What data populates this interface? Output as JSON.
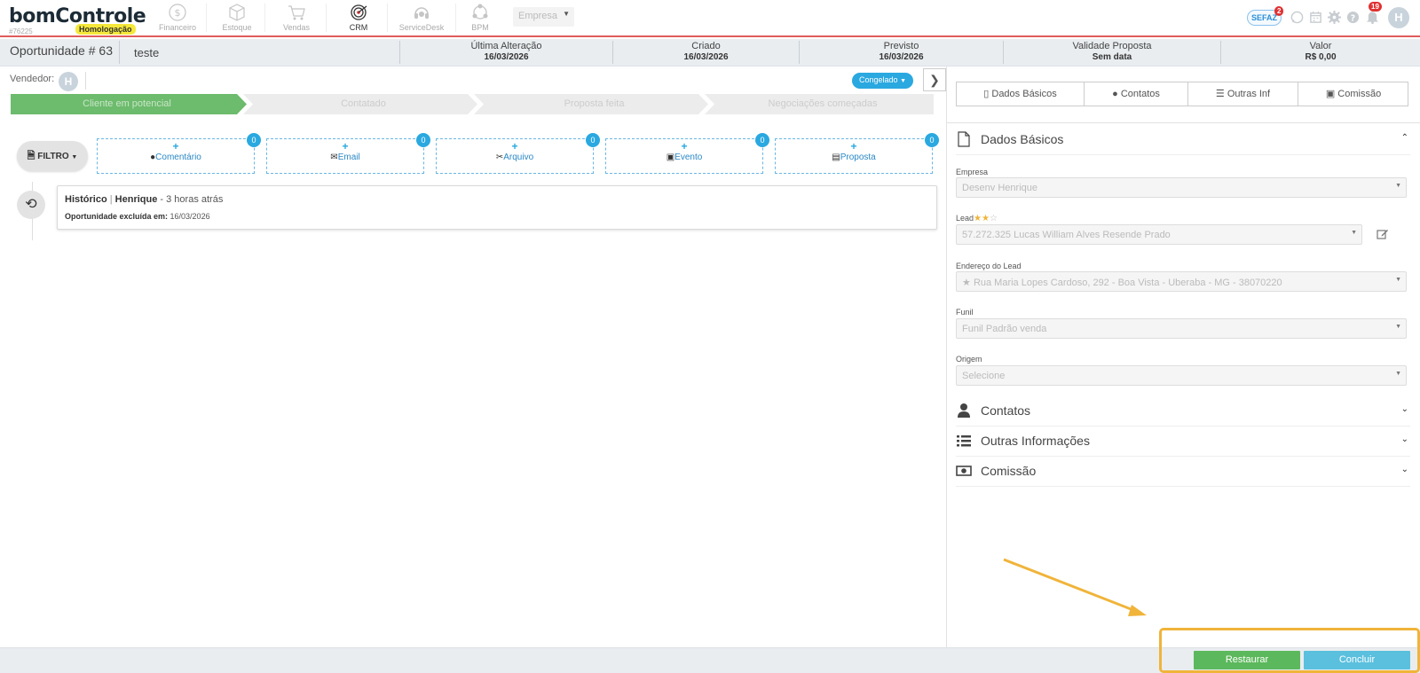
{
  "topnav": {
    "brand": "bomControle",
    "account_code": "#76225",
    "environment": "Homologação",
    "modules": [
      {
        "label": "Financeiro",
        "icon": "dollar-icon"
      },
      {
        "label": "Estoque",
        "icon": "box-icon"
      },
      {
        "label": "Vendas",
        "icon": "cart-icon"
      },
      {
        "label": "CRM",
        "icon": "target-icon"
      },
      {
        "label": "ServiceDesk",
        "icon": "headset-icon"
      },
      {
        "label": "BPM",
        "icon": "process-icon"
      }
    ],
    "company_placeholder": "Empresa",
    "sefaz_label": "SEFAZ",
    "sefaz_badge": "2",
    "notifications_badge": "19",
    "user_initial": "H"
  },
  "infobar": {
    "title": "Oportunidade # 63",
    "name": "teste",
    "ultima_alteracao_label": "Última Alteração",
    "ultima_alteracao": "16/03/2026",
    "criado_label": "Criado",
    "criado": "16/03/2026",
    "previsto_label": "Previsto",
    "previsto": "16/03/2026",
    "validade_label": "Validade Proposta",
    "validade": "Sem data",
    "valor_label": "Valor",
    "valor": "R$ 0,00"
  },
  "left": {
    "vendedor_label": "Vendedor:",
    "vendedor_initial": "H",
    "status_label": "Congelado",
    "stages": [
      "Cliente em potencial",
      "Contatado",
      "Proposta feita",
      "Negociações começadas"
    ],
    "filter_label": "FILTRO",
    "actions": [
      {
        "label": "Comentário",
        "count": "0"
      },
      {
        "label": "Email",
        "count": "0"
      },
      {
        "label": "Arquivo",
        "count": "0"
      },
      {
        "label": "Evento",
        "count": "0"
      },
      {
        "label": "Proposta",
        "count": "0"
      }
    ],
    "history": {
      "title": "Histórico",
      "user": "Henrique",
      "time": " - 3 horas atrás",
      "detail_label": "Oportunidade excluída em:",
      "detail_value": " 16/03/2026"
    }
  },
  "right": {
    "tabs": [
      "Dados Básicos",
      "Contatos",
      "Outras Inf",
      "Comissão"
    ],
    "section_dados": "Dados Básicos",
    "fields": {
      "empresa_label": "Empresa",
      "empresa_value": "Desenv Henrique",
      "lead_label": "Lead",
      "lead_value": "57.272.325 Lucas William Alves Resende Prado",
      "lead_rating": 2,
      "lead_rating_max": 3,
      "endereco_label": "Endereço do Lead",
      "endereco_value": "Rua Maria Lopes Cardoso, 292 - Boa Vista - Uberaba - MG - 38070220",
      "funil_label": "Funil",
      "funil_value": "Funil Padrão venda",
      "origem_label": "Origem",
      "origem_value": "Selecione"
    },
    "section_contatos": "Contatos",
    "section_outras": "Outras Informações",
    "section_comissao": "Comissão"
  },
  "footer": {
    "restore_label": "Restaurar",
    "conclude_label": "Concluir"
  },
  "colors": {
    "accent": "#2aa8e0",
    "stage_active": "#6dbb6d",
    "restore": "#5cb85c",
    "conclude": "#5bc0de",
    "highlight": "#f0b43a"
  }
}
